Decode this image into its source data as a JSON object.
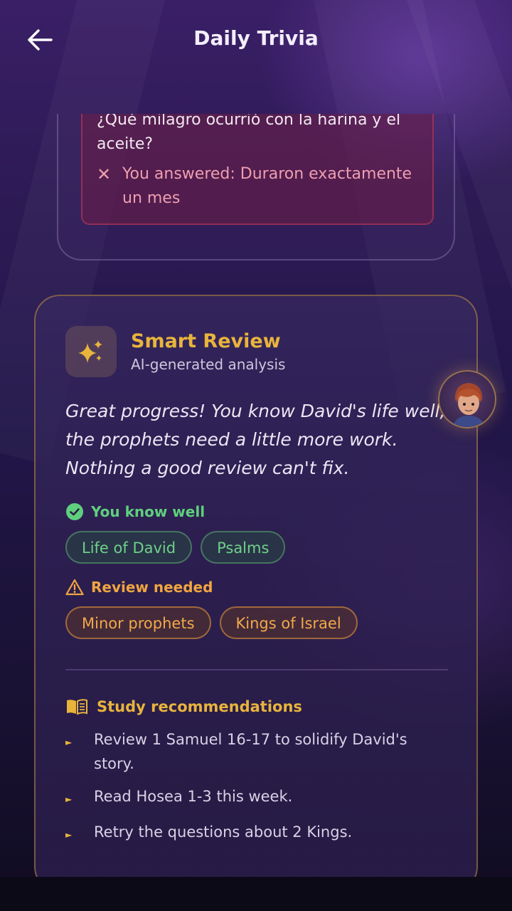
{
  "header": {
    "title": "Daily Trivia"
  },
  "question_card": {
    "question": "¿Qué milagro ocurrió con la harina y el aceite?",
    "answer_icon": "x-icon",
    "your_answer": "You answered: Duraron exactamente un mes"
  },
  "smart_review": {
    "title": "Smart Review",
    "subtitle": "AI-generated analysis",
    "summary": "Great progress! You know David's life well; the prophets need a little more work. Nothing a good review can't fix.",
    "strengths": {
      "heading": "You know well",
      "chips": [
        "Life of David",
        "Psalms"
      ]
    },
    "weaknesses": {
      "heading": "Review needed",
      "chips": [
        "Minor prophets",
        "Kings of Israel"
      ]
    },
    "study": {
      "heading": "Study recommendations",
      "items": [
        "Review 1 Samuel 16-17 to solidify David's story.",
        "Read Hosea 1-3 this week.",
        "Retry the questions about 2 Kings."
      ]
    }
  },
  "colors": {
    "accent_gold": "#e8b43c",
    "good_green": "#5fcf7d",
    "warn_orange": "#f0a540",
    "error_pink": "#ee9fb0"
  }
}
